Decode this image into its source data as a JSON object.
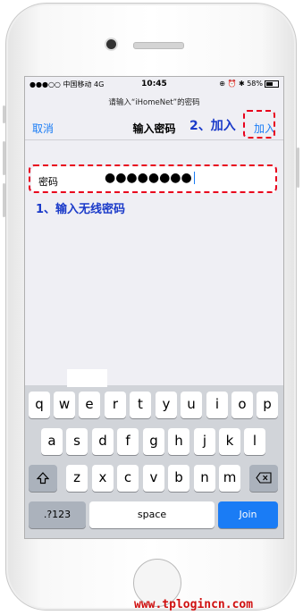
{
  "status_bar": {
    "carrier": "●●●○○ 中国移动 4G",
    "time": "10:45",
    "right": "⊕ ⏰ ✱ 58%"
  },
  "prompt": "请输入“iHomeNet”的密码",
  "nav": {
    "cancel": "取消",
    "title": "输入密码",
    "join": "加入"
  },
  "password_field": {
    "label": "密码",
    "value": "●●●●●●●●"
  },
  "annotations": {
    "step1": "1、输入无线密码",
    "step2": "2、加入"
  },
  "keyboard": {
    "row1": [
      "q",
      "w",
      "e",
      "r",
      "t",
      "y",
      "u",
      "i",
      "o",
      "p"
    ],
    "row2": [
      "a",
      "s",
      "d",
      "f",
      "g",
      "h",
      "j",
      "k",
      "l"
    ],
    "row3": [
      "z",
      "x",
      "c",
      "v",
      "b",
      "n",
      "m"
    ],
    "shift_icon": "shift-icon",
    "delete_icon": "delete-icon",
    "numbers_label": ".?123",
    "space_label": "space",
    "join_label": "Join"
  },
  "watermark": "www.tplogincn.com",
  "colors": {
    "ios_blue": "#1a7cf5",
    "annotation_red": "#e8001c",
    "annotation_blue": "#1a3ac9"
  }
}
